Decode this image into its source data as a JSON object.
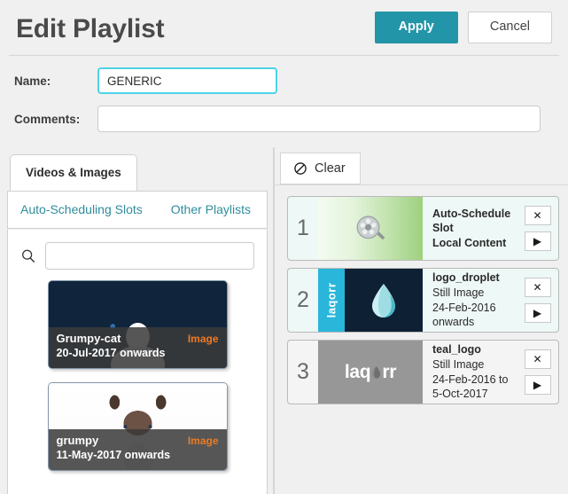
{
  "header": {
    "title": "Edit Playlist",
    "apply_label": "Apply",
    "cancel_label": "Cancel"
  },
  "form": {
    "name_label": "Name:",
    "name_value": "GENERIC",
    "comments_label": "Comments:",
    "comments_value": "",
    "comments_placeholder": ""
  },
  "left_panel": {
    "active_tab": "Videos & Images",
    "sub_tabs": [
      {
        "label": "Auto-Scheduling Slots"
      },
      {
        "label": "Other Playlists"
      }
    ],
    "search": {
      "value": "",
      "placeholder": "",
      "icon": "search-icon"
    },
    "media_cards": [
      {
        "name": "Grumpy-cat",
        "type": "Image",
        "date": "20-Jul-2017 onwards"
      },
      {
        "name": "grumpy",
        "type": "Image",
        "date": "11-May-2017 onwards"
      }
    ]
  },
  "right_panel": {
    "clear_label": "Clear",
    "clear_icon": "ban-icon",
    "remove_icon": "close-icon",
    "play_icon": "play-icon",
    "rows": [
      {
        "index": "1",
        "title": "Auto-Schedule Slot",
        "meta1": "Local Content",
        "meta2": "",
        "thumb": "auto-schedule-slot",
        "tint": "mint"
      },
      {
        "index": "2",
        "title": "logo_droplet",
        "meta1": "Still Image",
        "meta2": "24-Feb-2016 onwards",
        "thumb": "logo-droplet",
        "tint": "mint",
        "brand_text": "laqorr"
      },
      {
        "index": "3",
        "title": "teal_logo",
        "meta1": "Still Image",
        "meta2": "24-Feb-2016 to 5-Oct-2017",
        "thumb": "teal-logo",
        "tint": "gray",
        "brand_prefix": "laq",
        "brand_suffix": "rr"
      }
    ]
  },
  "colors": {
    "accent_teal": "#2395a8",
    "link_teal": "#2f8c9b",
    "orange_badge": "#ee7a22",
    "focus_cyan": "#4cd3e8",
    "droplet_cyan": "#2ab6db",
    "droplet_navy": "#0e2134",
    "gray_logo_bg": "#979797"
  }
}
